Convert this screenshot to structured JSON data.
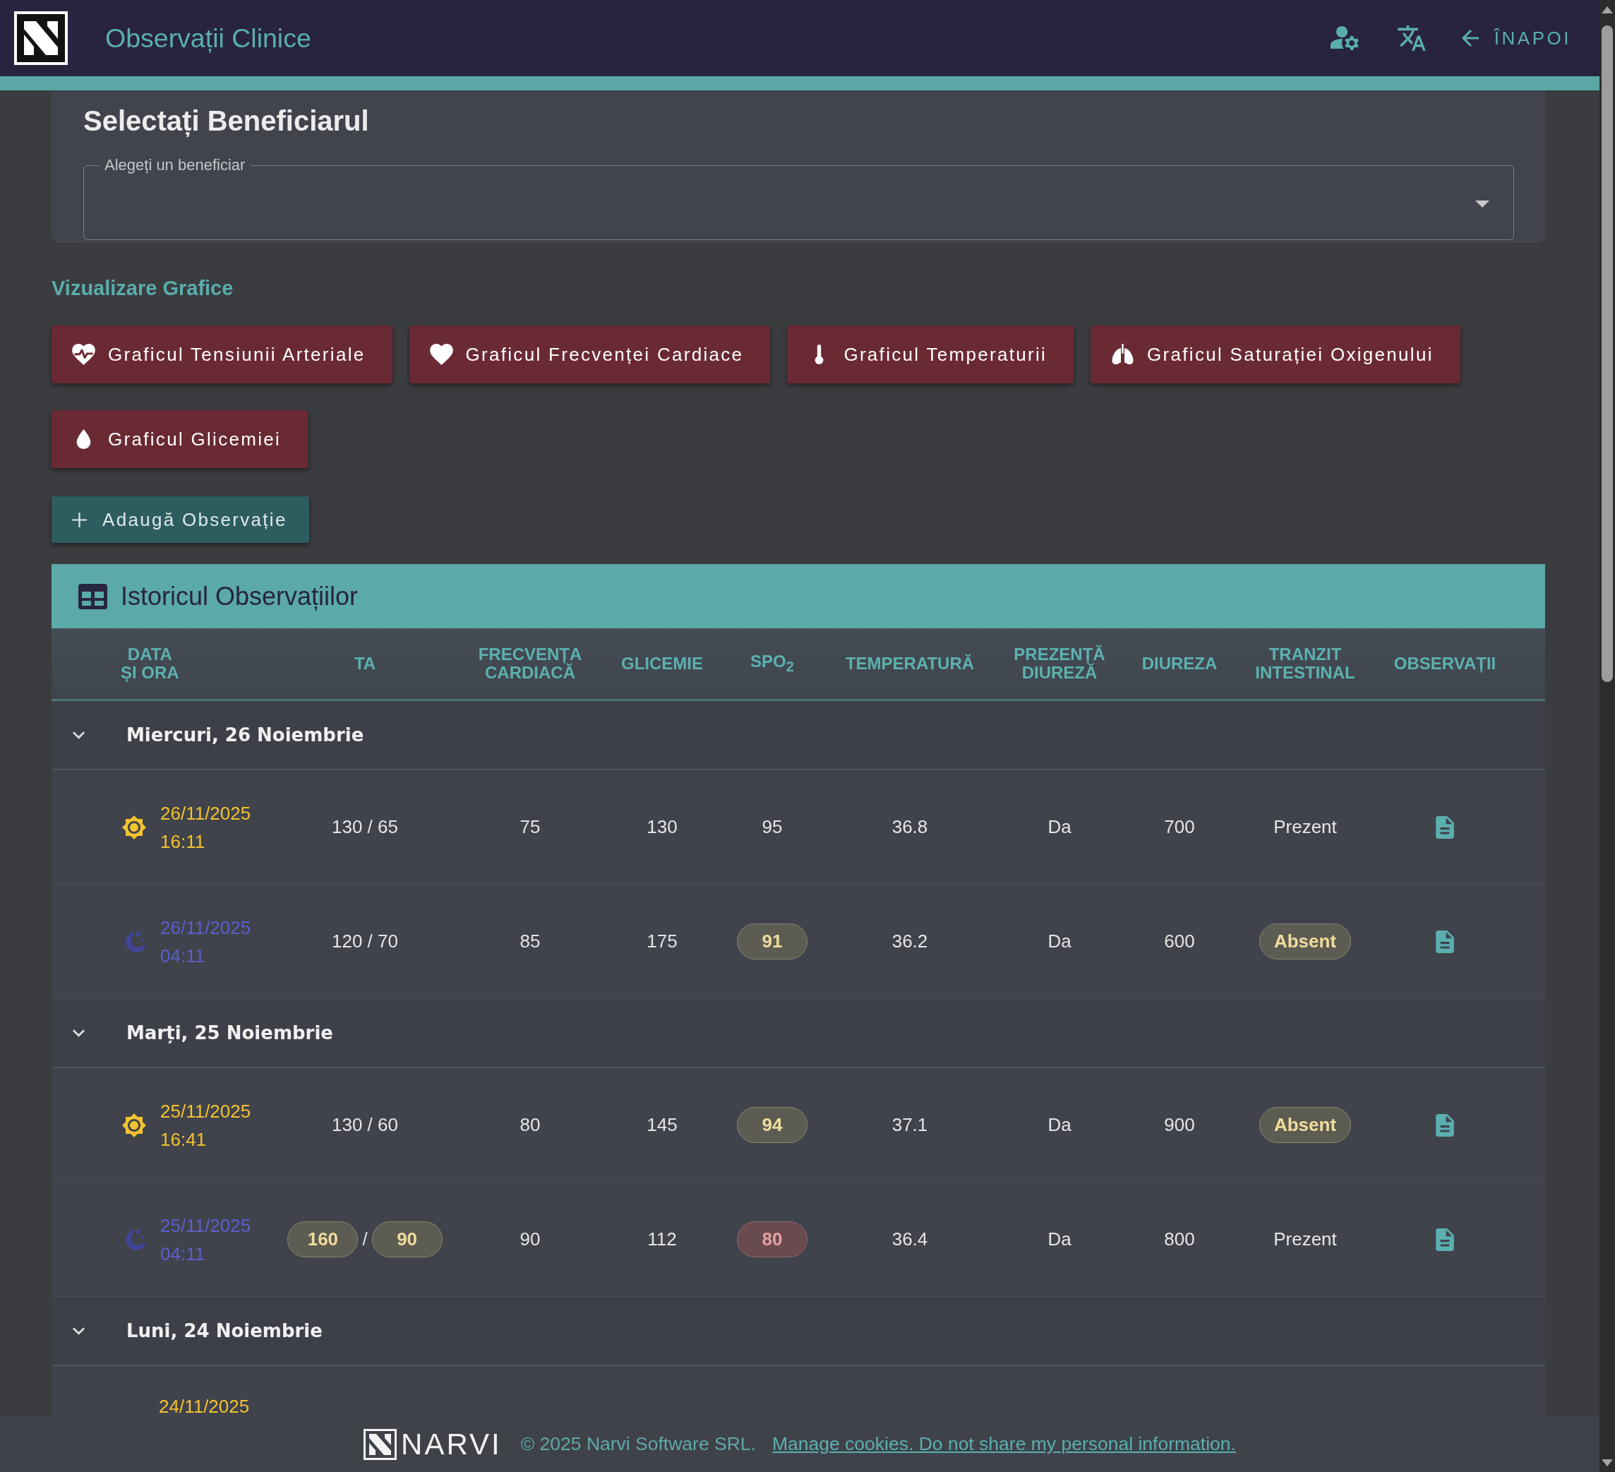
{
  "header": {
    "title": "Observații Clinice",
    "back_button": "ÎNAPOI"
  },
  "beneficiary": {
    "title": "Selectați Beneficiarul",
    "select_label": "Alegeți un beneficiar"
  },
  "charts": {
    "title": "Vizualizare Grafice",
    "buttons": [
      {
        "label": "Graficul Tensiunii Arteriale",
        "kind": "blood_pressure"
      },
      {
        "label": "Graficul Frecvenței Cardiace",
        "kind": "heart_rate"
      },
      {
        "label": "Graficul Temperaturii",
        "kind": "temperature"
      },
      {
        "label": "Graficul Saturației Oxigenului",
        "kind": "oxygen"
      },
      {
        "label": "Graficul Glicemiei",
        "kind": "glycemia"
      }
    ]
  },
  "add_button": "Adaugă Observație",
  "history": {
    "title": "Istoricul Observațiilor",
    "columns": [
      "DATA\nȘI ORA",
      "TA",
      "FRECVENȚA\nCARDIACĂ",
      "GLICEMIE",
      "SPO$_{2}$",
      "TEMPERATURĂ",
      "PREZENȚĂ\nDIUREZĂ",
      "DIUREZA",
      "TRANZIT\nINTESTINAL",
      "OBSERVAȚII"
    ],
    "groups": [
      {
        "label": "Miercuri, 26 Noiembrie",
        "expanded": true,
        "rows": [
          {
            "kind": "day",
            "date": "26/11/2025",
            "time": "16:11",
            "cells": [
              {
                "kind": "plain",
                "value": "130 / 65"
              },
              {
                "kind": "plain",
                "value": "75"
              },
              {
                "kind": "plain",
                "value": "130"
              },
              {
                "kind": "plain",
                "value": "95"
              },
              {
                "kind": "plain",
                "value": "36.8"
              },
              {
                "kind": "plain",
                "value": "Da"
              },
              {
                "kind": "plain",
                "value": "700"
              },
              {
                "kind": "plain",
                "value": "Prezent"
              }
            ]
          },
          {
            "kind": "night",
            "date": "26/11/2025",
            "time": "04:11",
            "cells": [
              {
                "kind": "plain",
                "value": "120 / 70"
              },
              {
                "kind": "plain",
                "value": "85"
              },
              {
                "kind": "plain",
                "value": "175"
              },
              {
                "kind": "warning",
                "value": "91"
              },
              {
                "kind": "plain",
                "value": "36.2"
              },
              {
                "kind": "plain",
                "value": "Da"
              },
              {
                "kind": "plain",
                "value": "600"
              },
              {
                "kind": "warning",
                "value": "Absent"
              }
            ]
          }
        ]
      },
      {
        "label": "Marți, 25 Noiembrie",
        "expanded": true,
        "rows": [
          {
            "kind": "day",
            "date": "25/11/2025",
            "time": "16:41",
            "cells": [
              {
                "kind": "plain",
                "value": "130 / 60"
              },
              {
                "kind": "plain",
                "value": "80"
              },
              {
                "kind": "plain",
                "value": "145"
              },
              {
                "kind": "warning",
                "value": "94"
              },
              {
                "kind": "plain",
                "value": "37.1"
              },
              {
                "kind": "plain",
                "value": "Da"
              },
              {
                "kind": "plain",
                "value": "900"
              },
              {
                "kind": "warning",
                "value": "Absent"
              }
            ]
          },
          {
            "kind": "night",
            "date": "25/11/2025",
            "time": "04:11",
            "cells": [
              {
                "kind": "pressure",
                "parts": [
                  {
                    "kind": "warning",
                    "value": "160"
                  },
                  {
                    "kind": "warning",
                    "value": "90"
                  }
                ],
                "separator": "/"
              },
              {
                "kind": "plain",
                "value": "90"
              },
              {
                "kind": "plain",
                "value": "112"
              },
              {
                "kind": "critical",
                "value": "80"
              },
              {
                "kind": "plain",
                "value": "36.4"
              },
              {
                "kind": "plain",
                "value": "Da"
              },
              {
                "kind": "plain",
                "value": "800"
              },
              {
                "kind": "plain",
                "value": "Prezent"
              }
            ]
          }
        ]
      },
      {
        "label": "Luni, 24 Noiembrie",
        "expanded": true,
        "rows": [
          {
            "kind": "day",
            "date": "24/11/2025"
          }
        ]
      }
    ]
  },
  "footer": {
    "brand": "NARVI",
    "copyright": "© 2025 Narvi Software SRL.",
    "link": "Manage cookies. Do not share my personal information."
  }
}
